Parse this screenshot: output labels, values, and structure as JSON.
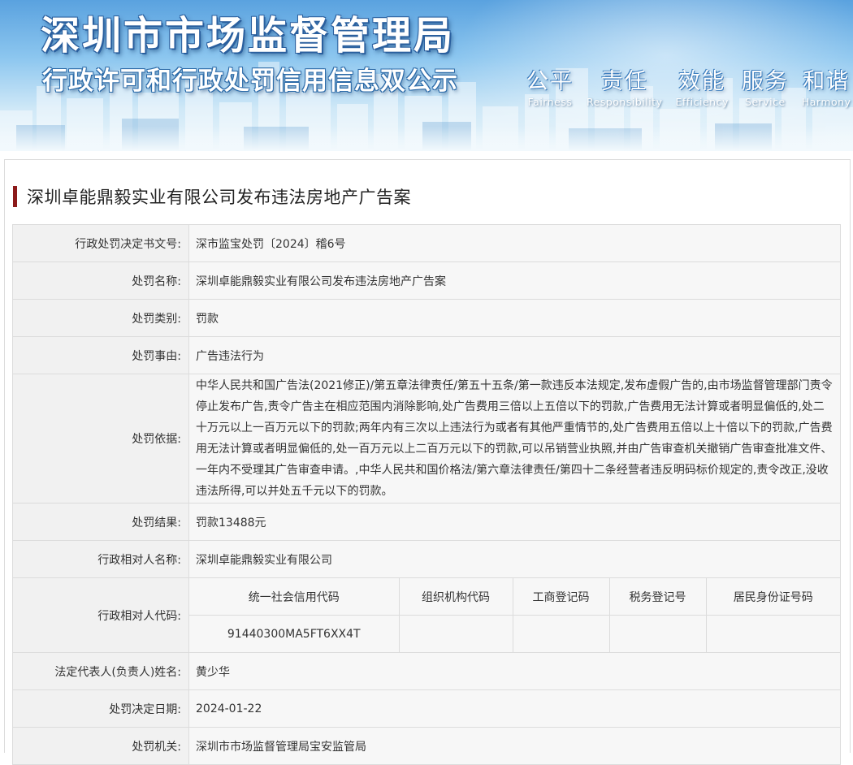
{
  "banner": {
    "title": "深圳市市场监督管理局",
    "subtitle": "行政许可和行政处罚信用信息双公示",
    "slogans": [
      {
        "cn": "公平",
        "en": "Fairness"
      },
      {
        "cn": "责任",
        "en": "Responsibility"
      },
      {
        "cn": "效能",
        "en": "Efficiency"
      },
      {
        "cn": "服务",
        "en": "Service"
      },
      {
        "cn": "和谐",
        "en": "Harmony"
      }
    ]
  },
  "case_title": "深圳卓能鼎毅实业有限公司发布违法房地产广告案",
  "colors": {
    "title_bar": "#8c1a1a",
    "label_bg": "#f1f1f1",
    "value_bg": "#f7f7f7",
    "border": "#dcdcdc"
  },
  "fields": {
    "decision_no": {
      "label": "行政处罚决定书文号:",
      "value": "深市监宝处罚〔2024〕稽6号"
    },
    "penalty_name": {
      "label": "处罚名称:",
      "value": "深圳卓能鼎毅实业有限公司发布违法房地产广告案"
    },
    "penalty_type": {
      "label": "处罚类别:",
      "value": "罚款"
    },
    "penalty_reason": {
      "label": "处罚事由:",
      "value": "广告违法行为"
    },
    "penalty_basis": {
      "label": "处罚依据:",
      "value": "中华人民共和国广告法(2021修正)/第五章法律责任/第五十五条/第一款违反本法规定,发布虚假广告的,由市场监督管理部门责令停止发布广告,责令广告主在相应范围内消除影响,处广告费用三倍以上五倍以下的罚款,广告费用无法计算或者明显偏低的,处二十万元以上一百万元以下的罚款;两年内有三次以上违法行为或者有其他严重情节的,处广告费用五倍以上十倍以下的罚款,广告费用无法计算或者明显偏低的,处一百万元以上二百万元以下的罚款,可以吊销营业执照,并由广告审查机关撤销广告审查批准文件、一年内不受理其广告审查申请。,中华人民共和国价格法/第六章法律责任/第四十二条经营者违反明码标价规定的,责令改正,没收违法所得,可以并处五千元以下的罚款。"
    },
    "penalty_result": {
      "label": "处罚结果:",
      "value": "罚款13488元"
    },
    "party_name": {
      "label": "行政相对人名称:",
      "value": "深圳卓能鼎毅实业有限公司"
    },
    "party_code": {
      "label": "行政相对人代码:",
      "headers": [
        "统一社会信用代码",
        "组织机构代码",
        "工商登记码",
        "税务登记号",
        "居民身份证号码"
      ],
      "values": [
        "91440300MA5FT6XX4T",
        "",
        "",
        "",
        ""
      ]
    },
    "legal_rep": {
      "label": "法定代表人(负责人)姓名:",
      "value": "黄少华"
    },
    "decision_date": {
      "label": "处罚决定日期:",
      "value": "2024-01-22"
    },
    "authority": {
      "label": "处罚机关:",
      "value": "深圳市市场监督管理局宝安监管局"
    }
  }
}
